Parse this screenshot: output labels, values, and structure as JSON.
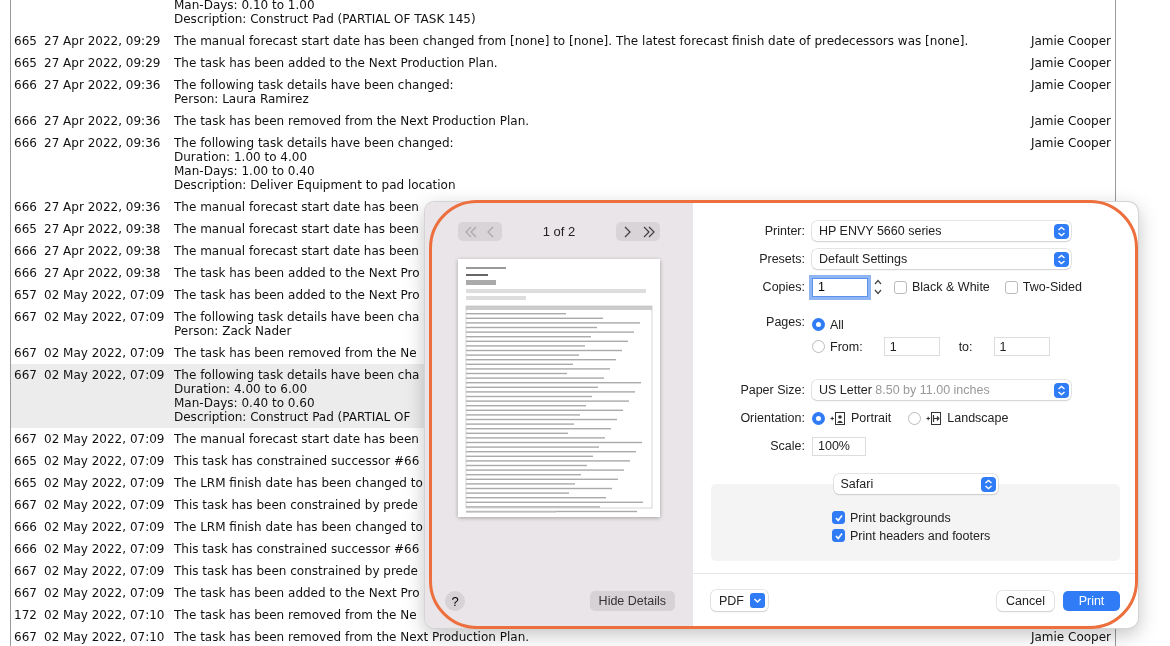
{
  "log": {
    "rows": [
      {
        "lines": [
          "Man-Days: 0.10 to 1.00",
          "Description: Construct Pad (PARTIAL OF TASK 145)"
        ],
        "selected": false
      },
      {
        "id": "665",
        "time": "27 Apr 2022, 09:29",
        "lines": [
          "The manual forecast start date has been changed from [none] to [none]. The latest forecast finish date of predecessors was [none]."
        ],
        "user": "Jamie Cooper",
        "selected": false
      },
      {
        "id": "665",
        "time": "27 Apr 2022, 09:29",
        "lines": [
          "The task has been added to the Next Production Plan."
        ],
        "user": "Jamie Cooper",
        "selected": false
      },
      {
        "id": "666",
        "time": "27 Apr 2022, 09:36",
        "lines": [
          "The following task details have been changed:",
          "Person: Laura Ramirez"
        ],
        "user": "Jamie Cooper",
        "selected": false
      },
      {
        "id": "666",
        "time": "27 Apr 2022, 09:36",
        "lines": [
          "The task has been removed from the Next Production Plan."
        ],
        "user": "Jamie Cooper",
        "selected": false
      },
      {
        "id": "666",
        "time": "27 Apr 2022, 09:36",
        "lines": [
          "The following task details have been changed:",
          "Duration: 1.00 to 4.00",
          "Man-Days: 1.00 to 0.40",
          "Description: Deliver Equipment to pad location"
        ],
        "user": "Jamie Cooper",
        "selected": false
      },
      {
        "id": "666",
        "time": "27 Apr 2022, 09:36",
        "lines": [
          "The manual forecast start date has been"
        ],
        "selected": false
      },
      {
        "id": "665",
        "time": "27 Apr 2022, 09:38",
        "lines": [
          "The manual forecast start date has been"
        ],
        "selected": false
      },
      {
        "id": "666",
        "time": "27 Apr 2022, 09:38",
        "lines": [
          "The manual forecast start date has been"
        ],
        "selected": false
      },
      {
        "id": "666",
        "time": "27 Apr 2022, 09:38",
        "lines": [
          "The task has been added to the Next Pro"
        ],
        "selected": false
      },
      {
        "id": "657",
        "time": "02 May 2022, 07:09",
        "lines": [
          "The task has been added to the Next Pro"
        ],
        "selected": false
      },
      {
        "id": "667",
        "time": "02 May 2022, 07:09",
        "lines": [
          "The following task details have been cha",
          "Person: Zack Nader"
        ],
        "selected": false
      },
      {
        "id": "667",
        "time": "02 May 2022, 07:09",
        "lines": [
          "The task has been removed from the Ne"
        ],
        "selected": false
      },
      {
        "id": "667",
        "time": "02 May 2022, 07:09",
        "lines": [
          "The following task details have been cha",
          "Duration: 4.00 to 6.00",
          "Man-Days: 0.40 to 0.60",
          "Description: Construct Pad (PARTIAL OF"
        ],
        "selected": true
      },
      {
        "id": "667",
        "time": "02 May 2022, 07:09",
        "lines": [
          "The manual forecast start date has been"
        ],
        "selected": false
      },
      {
        "id": "665",
        "time": "02 May 2022, 07:09",
        "lines": [
          "This task has constrained successor #66"
        ],
        "selected": false
      },
      {
        "id": "665",
        "time": "02 May 2022, 07:09",
        "lines": [
          "The LRM finish date has been changed to"
        ],
        "selected": false
      },
      {
        "id": "667",
        "time": "02 May 2022, 07:09",
        "lines": [
          "This task has been constrained by prede"
        ],
        "selected": false
      },
      {
        "id": "666",
        "time": "02 May 2022, 07:09",
        "lines": [
          "The LRM finish date has been changed to"
        ],
        "selected": false
      },
      {
        "id": "666",
        "time": "02 May 2022, 07:09",
        "lines": [
          "This task has constrained successor #66"
        ],
        "selected": false
      },
      {
        "id": "667",
        "time": "02 May 2022, 07:09",
        "lines": [
          "This task has been constrained by prede"
        ],
        "selected": false
      },
      {
        "id": "667",
        "time": "02 May 2022, 07:09",
        "lines": [
          "The task has been added to the Next Pro"
        ],
        "selected": false
      },
      {
        "id": "172",
        "time": "02 May 2022, 07:10",
        "lines": [
          "The task has been removed from the Ne"
        ],
        "selected": false
      },
      {
        "id": "667",
        "time": "02 May 2022, 07:10",
        "lines": [
          "The task has been removed from the Next Production Plan."
        ],
        "user": "Jamie Cooper",
        "selected": false
      }
    ]
  },
  "print_dialog": {
    "preview": {
      "nav_buttons": [
        {
          "kind": "first",
          "disabled": true
        },
        {
          "kind": "prev",
          "disabled": true
        },
        {
          "kind": "next",
          "disabled": false
        },
        {
          "kind": "last",
          "disabled": false
        }
      ],
      "page_indicator": "1 of 2",
      "help": "?",
      "hide_details": "Hide Details"
    },
    "printer": {
      "label": "Printer:",
      "value": "HP ENVY 5660 series"
    },
    "presets": {
      "label": "Presets:",
      "value": "Default Settings"
    },
    "copies": {
      "label": "Copies:",
      "value": "1",
      "focused": true,
      "options": [
        {
          "label": "Black & White",
          "checked": false
        },
        {
          "label": "Two-Sided",
          "checked": false
        }
      ]
    },
    "pages": {
      "label": "Pages:",
      "options": [
        {
          "label": "All",
          "selected": true
        },
        {
          "label": "From:",
          "selected": false
        }
      ],
      "from": "1",
      "to_label": "to:",
      "to": "1"
    },
    "paper_size": {
      "label": "Paper Size:",
      "value": "US Letter",
      "detail": "8.50 by 11.00 inches"
    },
    "orientation": {
      "label": "Orientation:",
      "options": [
        {
          "kind": "portrait",
          "label": "Portrait",
          "selected": true
        },
        {
          "kind": "landscape",
          "label": "Landscape",
          "selected": false
        }
      ]
    },
    "scale": {
      "label": "Scale:",
      "value": "100%"
    },
    "app_section": {
      "select": "Safari",
      "options": [
        {
          "label": "Print backgrounds",
          "checked": true
        },
        {
          "label": "Print headers and footers",
          "checked": true
        }
      ]
    },
    "footer": {
      "pdf": "PDF",
      "cancel": "Cancel",
      "print": "Print"
    }
  }
}
